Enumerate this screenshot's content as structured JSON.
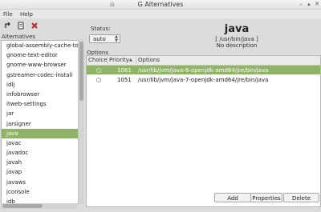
{
  "window": {
    "title": "G Alternatives"
  },
  "menu": {
    "file": "File",
    "help": "Help"
  },
  "sidebar": {
    "label": "Alternatives",
    "items": [
      "global-assembly-cache-tool",
      "gnome-text-editor",
      "gnome-www-browser",
      "gstreamer-codec-install",
      "idlj",
      "infobrowser",
      "itweb-settings",
      "jar",
      "jarsigner",
      "java",
      "javac",
      "javadoc",
      "javah",
      "javap",
      "javaws",
      "jconsole",
      "jdb"
    ],
    "selected_index": 9
  },
  "details": {
    "status_label": "Status:",
    "status_value": "auto",
    "name": "java",
    "link": "[ /usr/bin/java ]",
    "description": "No description"
  },
  "options": {
    "label": "Options",
    "columns": {
      "choice": "Choice",
      "priority": "Priority",
      "options": "Options"
    },
    "rows": [
      {
        "priority": "1061",
        "path": "/usr/lib/jvm/java-6-openjdk-amd64/jre/bin/java",
        "selected": true
      },
      {
        "priority": "1051",
        "path": "/usr/lib/jvm/java-7-openjdk-amd64/jre/bin/java",
        "selected": false
      }
    ]
  },
  "buttons": {
    "add": "Add",
    "properties": "Properties",
    "delete": "Delete"
  },
  "colors": {
    "selection": "#8fb468",
    "delete_icon": "#cc1f1f"
  }
}
